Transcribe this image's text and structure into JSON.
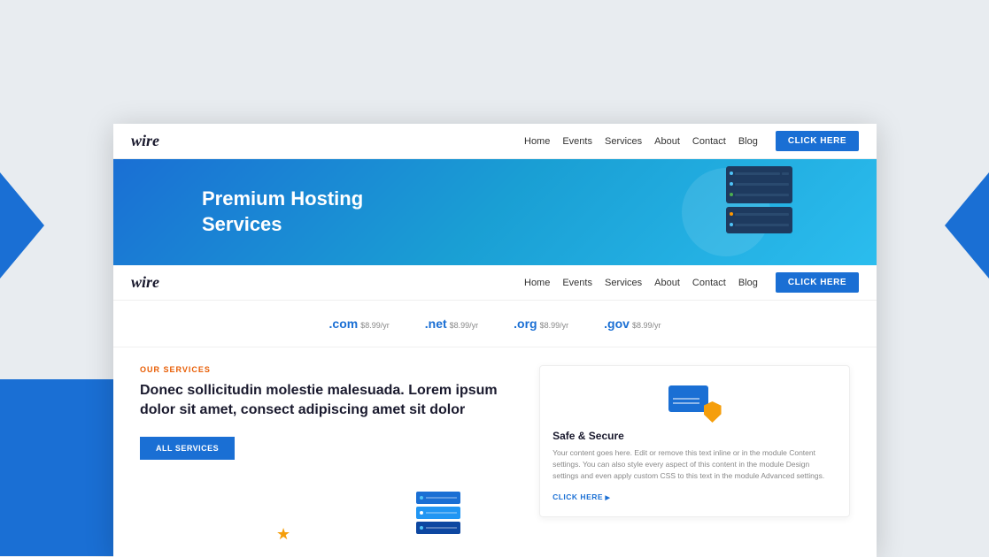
{
  "browser": {
    "navbar": {
      "logo": "wire",
      "links": [
        "Home",
        "Events",
        "Services",
        "About",
        "Contact",
        "Blog"
      ],
      "cta_button": "CLICK HERE"
    },
    "hero": {
      "title_line1": "Premium Hosting",
      "title_line2": "Services"
    },
    "navbar2": {
      "logo": "wire",
      "links": [
        "Home",
        "Events",
        "Services",
        "About",
        "Contact",
        "Blog"
      ],
      "cta_button": "CLICK HERE"
    },
    "domains": [
      {
        "ext": ".com",
        "price": "$8.99/yr"
      },
      {
        "ext": ".net",
        "price": "$8.99/yr"
      },
      {
        "ext": ".org",
        "price": "$8.99/yr"
      },
      {
        "ext": ".gov",
        "price": "$8.99/yr"
      }
    ],
    "services": {
      "label": "OUR SERVICES",
      "title": "Donec sollicitudin molestie malesuada. Lorem ipsum dolor sit amet, consect adipiscing amet sit dolor",
      "button": "ALL SERVICES",
      "card": {
        "title": "Safe & Secure",
        "text": "Your content goes here. Edit or remove this text inline or in the module Content settings. You can also style every aspect of this content in the module Design settings and even apply custom CSS to this text in the module Advanced settings.",
        "link": "CLICK HERE"
      }
    }
  }
}
